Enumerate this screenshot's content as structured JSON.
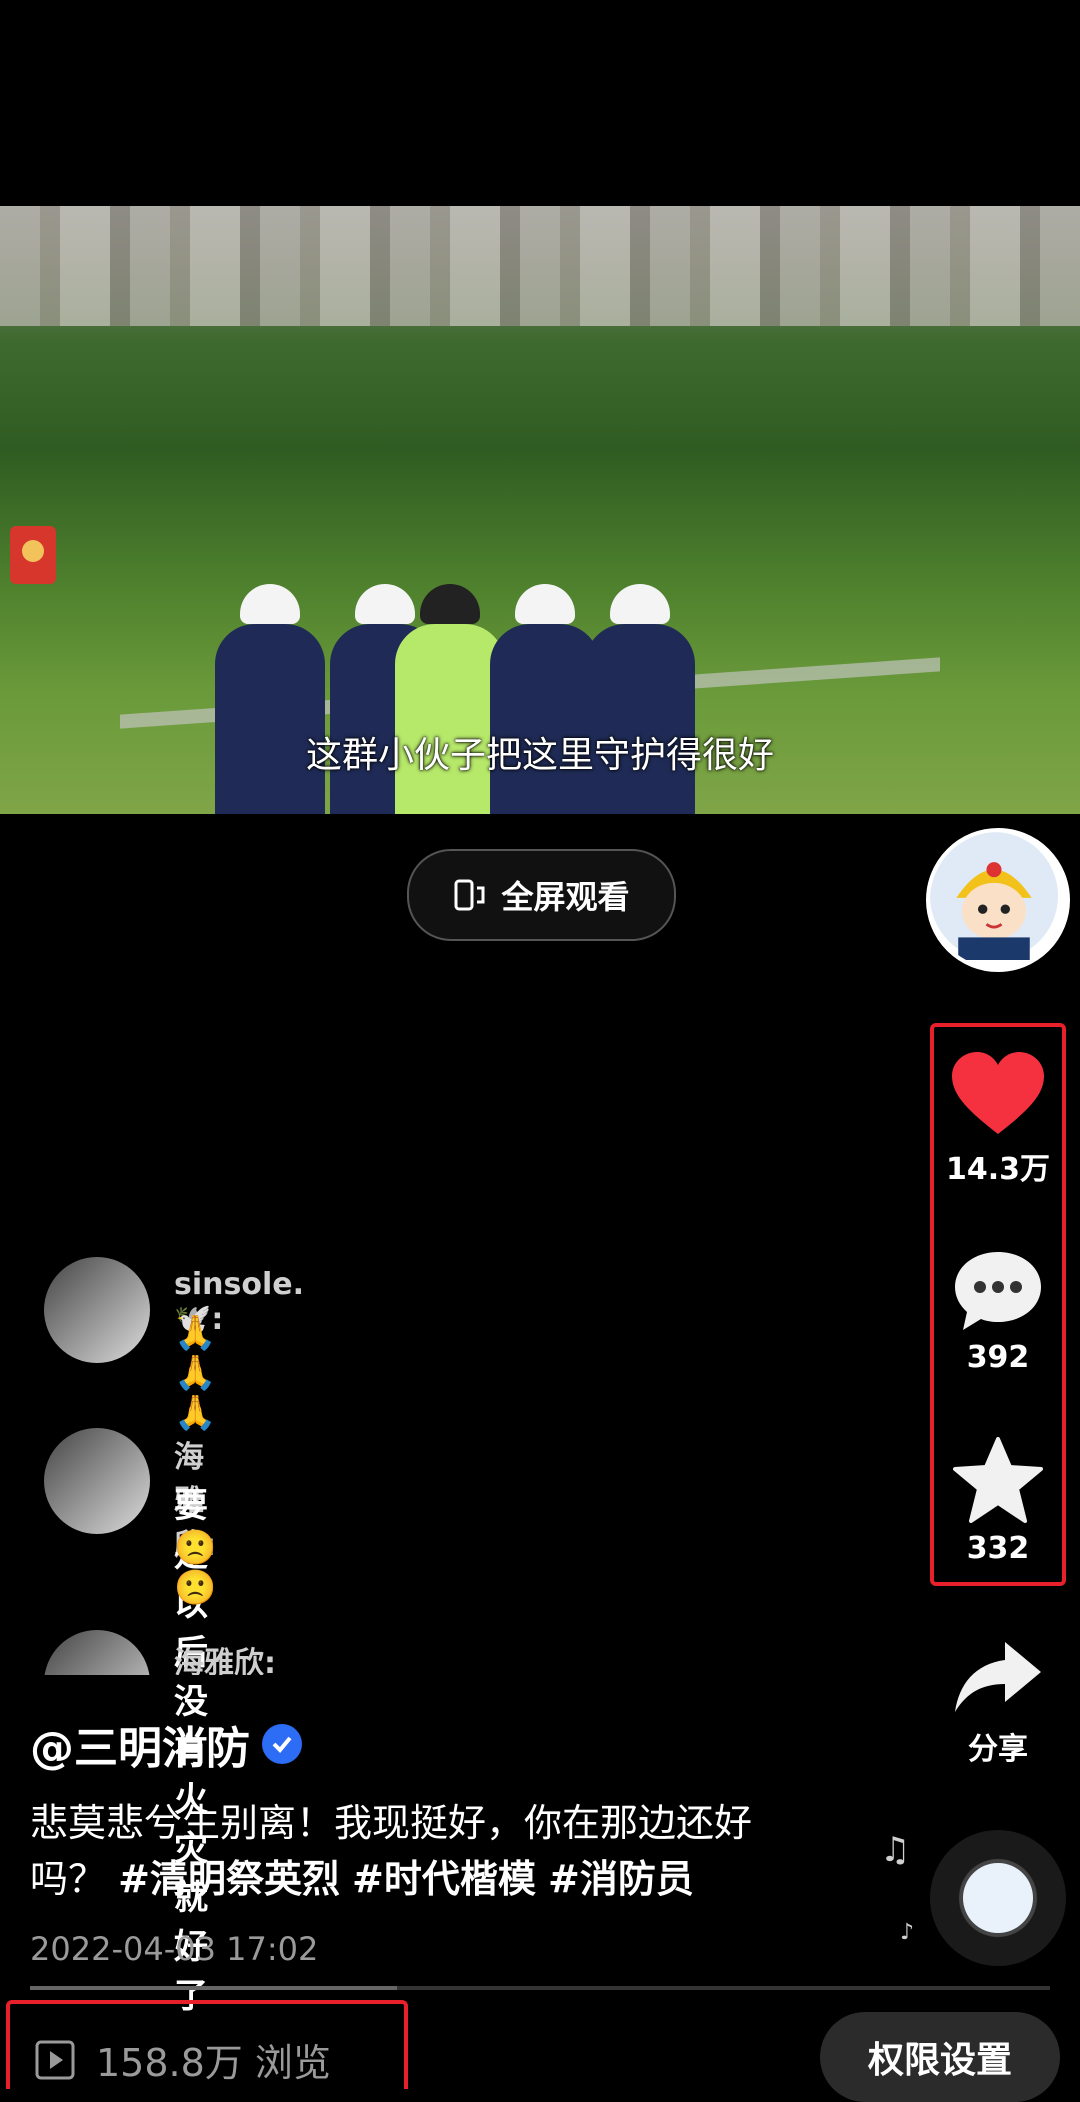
{
  "video": {
    "subtitle": "这群小伙子把这里守护得很好"
  },
  "fullscreen_button": {
    "label": "全屏观看"
  },
  "actions": {
    "like_count": "14.3万",
    "comment_count": "392",
    "favorite_count": "332",
    "share_label": "分享"
  },
  "comments": [
    {
      "user": "sinsole.🕊️:",
      "text": "🙏🙏🙏"
    },
    {
      "user": "海雅欣:",
      "text": "要是以后没有火灾就好了",
      "text2": "🙁🙁"
    },
    {
      "user": "海雅欣:"
    }
  ],
  "post": {
    "author": "@三明消防",
    "description": "悲莫悲兮生别离！我现挺好，你在那边还好吗？",
    "tags": [
      "#清明祭英烈",
      "#时代楷模",
      "#消防员"
    ],
    "date": "2022-04-03 17:02",
    "progress": 0.36
  },
  "footer": {
    "views": "158.8万 浏览",
    "permission_button": "权限设置"
  },
  "colors": {
    "like": "#f5313f",
    "highlight_box": "#e8202c",
    "verified": "#2d6cf4"
  },
  "icons": [
    "fullscreen-icon",
    "heart-icon",
    "comment-icon",
    "star-icon",
    "share-icon",
    "play-icon",
    "music-note-icon"
  ]
}
